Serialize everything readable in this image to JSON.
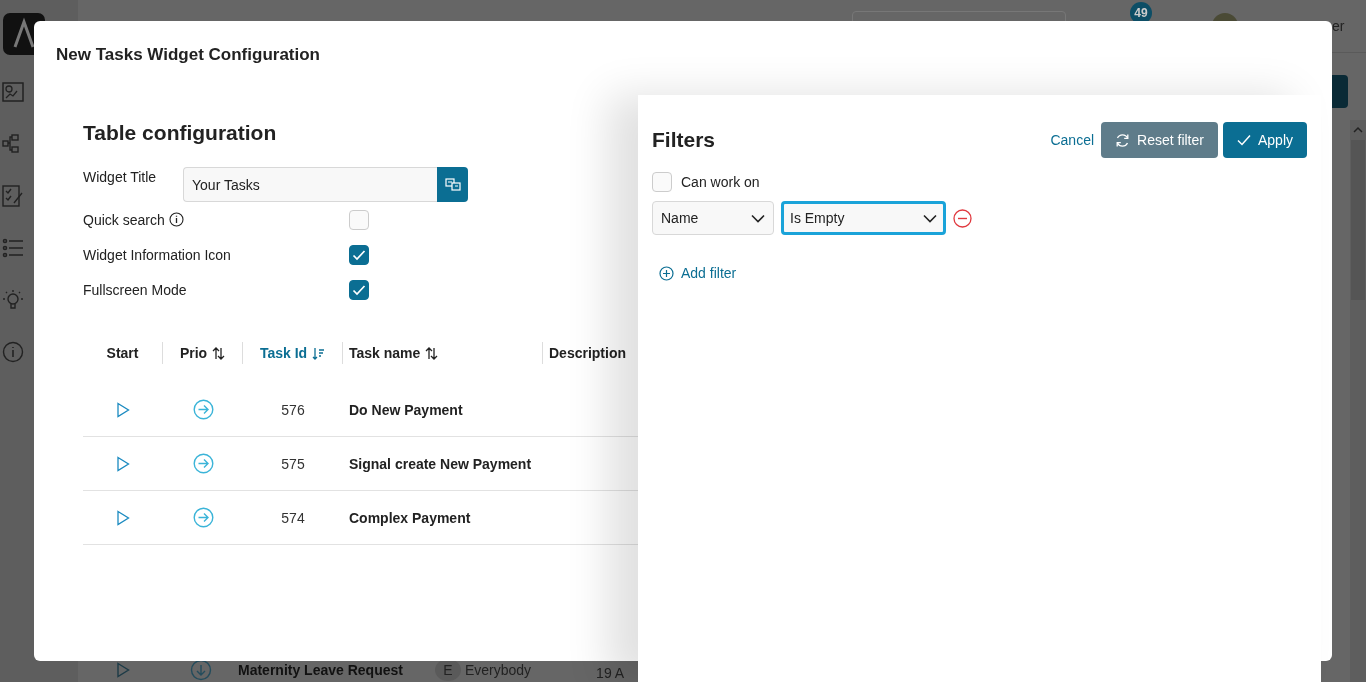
{
  "app": {
    "notification_count": "49",
    "user_name_fragment": "er",
    "background_row": {
      "task_name": "Maternity Leave Request",
      "assignee_initial": "E",
      "assignee": "Everybody",
      "date_fragment": "19 A"
    }
  },
  "modal": {
    "title": "New Tasks Widget Configuration",
    "section_title": "Table configuration",
    "widget_title": {
      "label": "Widget Title",
      "value": "Your Tasks"
    },
    "options": [
      {
        "label": "Quick search",
        "info": true,
        "checked": false
      },
      {
        "label": "Widget Information Icon",
        "info": false,
        "checked": true
      },
      {
        "label": "Fullscreen Mode",
        "info": false,
        "checked": true
      }
    ],
    "table": {
      "columns": [
        {
          "label": "Start",
          "sortable": false,
          "selected": false
        },
        {
          "label": "Prio",
          "sortable": true,
          "selected": false
        },
        {
          "label": "Task Id",
          "sortable": true,
          "selected": true
        },
        {
          "label": "Task name",
          "sortable": true,
          "selected": false
        },
        {
          "label": "Description",
          "sortable": false,
          "selected": false
        }
      ],
      "rows": [
        {
          "id": "576",
          "name": "Do New Payment"
        },
        {
          "id": "575",
          "name": "Signal create New Payment"
        },
        {
          "id": "574",
          "name": "Complex Payment"
        }
      ]
    }
  },
  "filters": {
    "title": "Filters",
    "cancel": "Cancel",
    "reset": "Reset filter",
    "apply": "Apply",
    "can_work_on": {
      "label": "Can work on",
      "checked": false
    },
    "conditions": [
      {
        "field": "Name",
        "operator": "Is Empty",
        "operator_focused": true
      }
    ],
    "add_filter": "Add filter"
  }
}
